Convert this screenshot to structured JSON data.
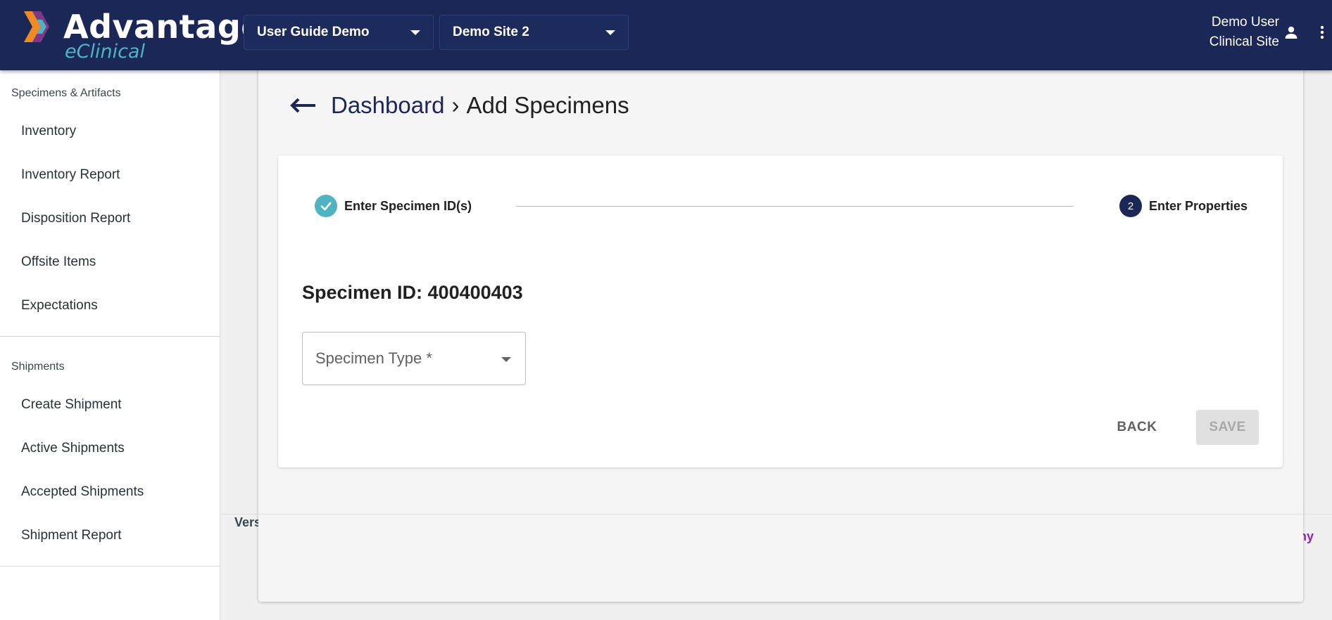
{
  "header": {
    "logo_title": "Advantage",
    "logo_subtitle": "eClinical",
    "study_selector": "User Guide Demo",
    "site_selector": "Demo Site 2",
    "user_name": "Demo User",
    "user_role": "Clinical Site"
  },
  "sidebar": {
    "sections": [
      {
        "heading": "Specimens & Artifacts",
        "items": [
          "Inventory",
          "Inventory Report",
          "Disposition Report",
          "Offsite Items",
          "Expectations"
        ]
      },
      {
        "heading": "Shipments",
        "items": [
          "Create Shipment",
          "Active Shipments",
          "Accepted Shipments",
          "Shipment Report"
        ]
      }
    ]
  },
  "breadcrumb": {
    "parent": "Dashboard",
    "separator": "›",
    "current": "Add Specimens"
  },
  "stepper": {
    "step1_label": "Enter Specimen ID(s)",
    "step2_number": "2",
    "step2_label": "Enter Properties"
  },
  "form": {
    "specimen_id": "Specimen ID: 400400403",
    "specimen_type_placeholder": "Specimen Type *",
    "back_label": "BACK",
    "save_label": "SAVE"
  },
  "footer": {
    "version_fragment": "Vers",
    "link_fragment": "ny"
  },
  "colors": {
    "header_bg": "#1b2756",
    "accent_teal": "#4fb3c2",
    "step_active": "#1b2756",
    "footer_link": "#8e24aa"
  }
}
